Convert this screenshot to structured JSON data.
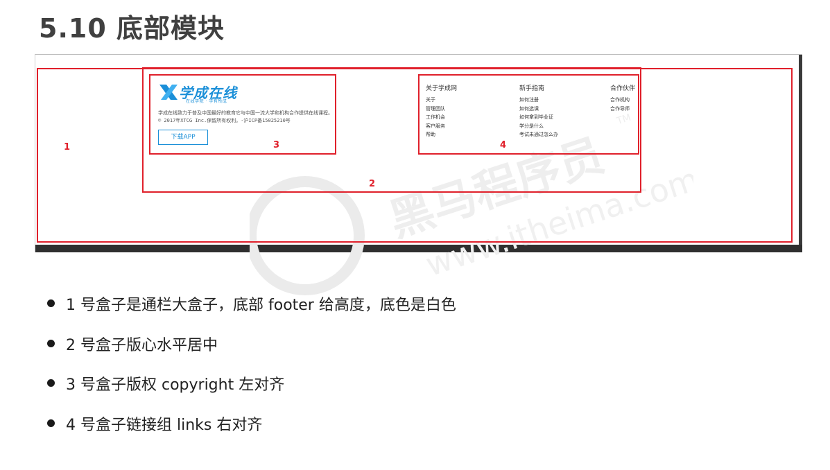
{
  "slide": {
    "title": "5.10 底部模块"
  },
  "footer_preview": {
    "logo_text": "学成在线",
    "logo_slogan": "在线学院 · 学有所成",
    "description": "学成在线致力于普及中国最好的教育它与中国一流大学和机构合作提供在线课程。",
    "copyright": "© 2017年XTCG Inc.保留所有权利。-沪ICP备15025210号",
    "app_button": "下载APP",
    "link_groups": [
      {
        "title": "关于学成网",
        "links": [
          "关于",
          "管理团队",
          "工作机会",
          "客户服务",
          "帮助"
        ]
      },
      {
        "title": "新手指南",
        "links": [
          "如何注册",
          "如何选课",
          "如何拿到毕业证",
          "学分是什么",
          "考试未通过怎么办"
        ]
      },
      {
        "title": "合作伙伴",
        "links": [
          "合作机构",
          "合作导师"
        ]
      }
    ]
  },
  "annotations": {
    "box1": "1",
    "box2": "2",
    "box3": "3",
    "box4": "4",
    "color": "#e0202b"
  },
  "watermark": {
    "brand": "黑马程序员",
    "url": "www.itheima.com",
    "tm": "TM"
  },
  "bullets": [
    "1 号盒子是通栏大盒子，底部 footer 给高度，底色是白色",
    "2 号盒子版心水平居中",
    "3 号盒子版权 copyright  左对齐",
    "4 号盒子链接组 links  右对齐"
  ]
}
